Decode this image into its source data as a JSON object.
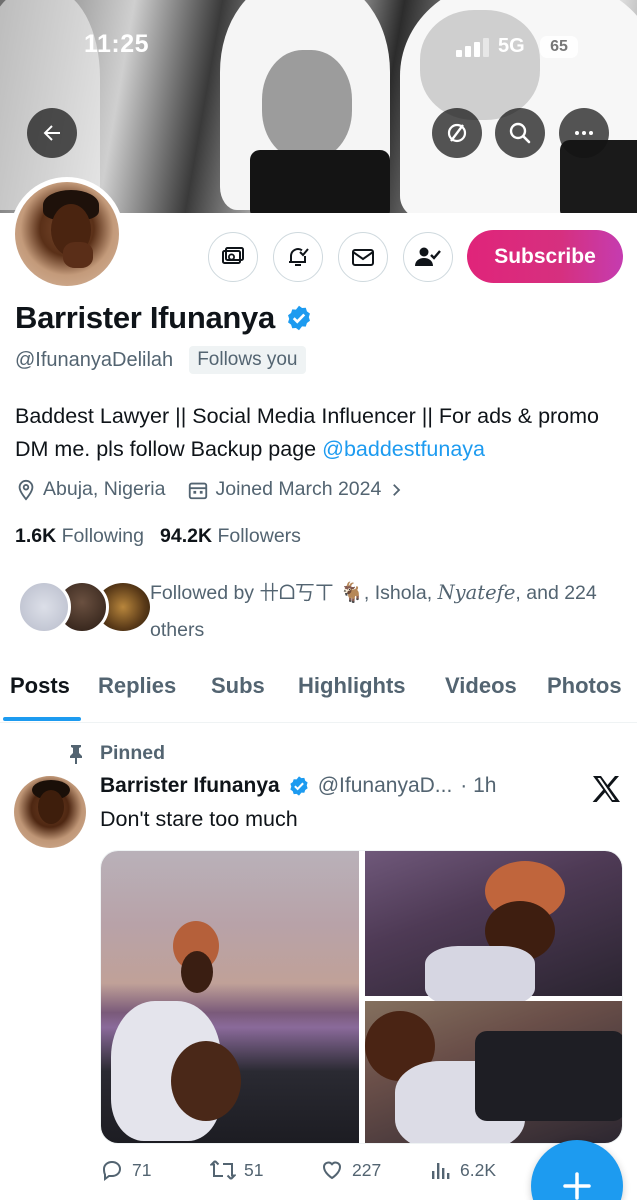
{
  "status_bar": {
    "time": "11:25",
    "network": "5G",
    "battery": "65"
  },
  "banner": {
    "icons": [
      "back-arrow-icon",
      "grok-icon",
      "search-icon",
      "more-icon"
    ]
  },
  "profile": {
    "name": "Barrister Ifunanya",
    "handle": "@IfunanyaDelilah",
    "follows_you": "Follows you",
    "verified": true,
    "bio_text": "Baddest Lawyer || Social Media Influencer || For ads & promo DM me. pls follow Backup page ",
    "bio_mention": "@baddestfunaya",
    "location": "Abuja, Nigeria",
    "joined": "Joined March 2024",
    "following_count": "1.6K",
    "following_label": "Following",
    "followers_count": "94.2K",
    "followers_label": "Followers",
    "followed_by_prefix": "Followed by ",
    "followed_by_name1": "卄ᗝ丂ㄒ 🐐",
    "followed_by_sep1": ", Ishola, ",
    "followed_by_name3": "Nyatefe",
    "followed_by_suffix": ", and 224 others",
    "subscribe_label": "Subscribe",
    "action_icons": [
      "monetization-icon",
      "notification-bell-icon",
      "message-icon",
      "following-icon"
    ]
  },
  "tabs": [
    "Posts",
    "Replies",
    "Subs",
    "Highlights",
    "Videos",
    "Photos"
  ],
  "active_tab": "Posts",
  "post": {
    "pinned_label": "Pinned",
    "author": "Barrister Ifunanya",
    "handle": "@IfunanyaD...",
    "time": "· 1h",
    "text": "Don't stare too much",
    "replies": "71",
    "reposts": "51",
    "likes": "227",
    "views": "6.2K"
  },
  "colors": {
    "accent": "#1d9bf0",
    "subscribe_start": "#e0247a",
    "subscribe_end": "#c53cb0",
    "muted": "#536471",
    "text": "#0f1419"
  }
}
